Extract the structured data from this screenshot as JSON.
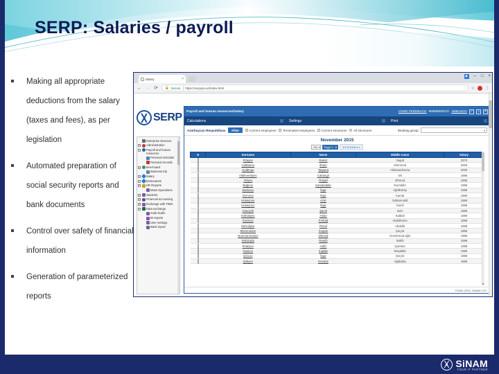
{
  "slide": {
    "title": "SERP: Salaries / payroll",
    "bullets": [
      "Making all appropriate deductions from the salary (taxes and fees), as per legislation",
      "Automated preparation of social security reports and bank documents",
      "Control over safety of financial information",
      "Generation of parameterized reports"
    ],
    "footer_logo": {
      "name": "SiNAM",
      "tagline": "YOUR IT PARTNER"
    }
  },
  "browser": {
    "tab": {
      "title": "Salary",
      "close_label": "×"
    },
    "window_controls": {
      "minimize": "–",
      "maximize": "□",
      "close": "×",
      "extra": "▲"
    },
    "toolbar": {
      "back": "←",
      "forward": "→",
      "reload": "⟳",
      "secure_label": "Secure",
      "url": "https://serpqsu.az/index.html",
      "bookmark": "☆",
      "menu": "⋮"
    }
  },
  "app": {
    "brand": "SERP",
    "titlebar": {
      "title": "Payroll and human resources/Salary",
      "user_feedback": "USER FEEDBACK",
      "user_prefix": "MƏMMƏDOV",
      "user_name": "ABBASOV",
      "btn_ok": "✓",
      "btn_help": "?",
      "btn_close": "✕"
    },
    "menubar": [
      {
        "label": "Calculations",
        "caret": "▤"
      },
      {
        "label": "Settings",
        "caret": "▤"
      },
      {
        "label": "Print",
        "caret": "▤"
      }
    ],
    "filterbar": {
      "org": "Azərbaycan Respublikası",
      "filter_button": "Filter",
      "checkboxes": [
        {
          "label": "Current employees",
          "type": "checkbox"
        },
        {
          "label": "Terminated employees",
          "type": "checkbox"
        },
        {
          "label": "Current structures",
          "type": "checkbox"
        },
        {
          "label": "All structures",
          "type": "radio"
        }
      ],
      "working_group_label": "Working group:",
      "working_group_value": "",
      "working_group_caret": "▾"
    },
    "period": "November 2015",
    "pagination": {
      "page_size": "250",
      "page_size_caret": "▾",
      "page_label": "Page 1 - 6",
      "page_numbers": "1 2 3 4 5 6 » »"
    },
    "table": {
      "columns": [
        "",
        "Surname",
        "Name",
        "Middle name",
        "Salary"
      ],
      "select_all": "■",
      "rows": [
        [
          "Rzayev",
          "Ramiz",
          "Yaqub",
          "3370"
        ],
        [
          "Cabbarov",
          "Ilham",
          "Məmməd",
          "2000"
        ],
        [
          "Goldman",
          "Tatyana",
          "Aleksandrovna",
          "2000"
        ],
        [
          "Allahverdiyev",
          "Cahangir",
          "Əli",
          "1986"
        ],
        [
          "Abiyev",
          "Rəşad",
          "Əhməd",
          "1986"
        ],
        [
          "Bağırov",
          "Kamaləddin",
          "Nurəddin",
          "1986"
        ],
        [
          "Zadəsəv",
          "İlqar",
          "Ağəlkəbəy",
          "1986"
        ],
        [
          "Dəmirov",
          "İlqar",
          "Kamal",
          "1986"
        ],
        [
          "Hüseynov",
          "Azər",
          "Soltanməlid",
          "1986"
        ],
        [
          "Hüseynov",
          "İlqar",
          "Kamil",
          "1986"
        ],
        [
          "Hüseynli",
          "Şamil",
          "Əziz",
          "1986"
        ],
        [
          "Kəlbəliyev",
          "Aslan",
          "Kalbali",
          "1986"
        ],
        [
          "Kərimov",
          "Fərhad",
          "Abdulkərim",
          "1986"
        ],
        [
          "Mirzəliyev",
          "Rəsul",
          "Abdulla",
          "1986"
        ],
        [
          "Məmmədov",
          "Xəqani",
          "Şəryət",
          "1986"
        ],
        [
          "Nurməmmədov",
          "Əhməd",
          "Gəsəhməd oğlu",
          "1986"
        ],
        [
          "Nəbizadə",
          "Ramib",
          "Sahib",
          "1986"
        ],
        [
          "Rzaliyev",
          "Hafiz",
          "Qəmbər",
          "1986"
        ],
        [
          "Nəsirov",
          "İnqilab",
          "Məşallah",
          "1986"
        ],
        [
          "Qılıcov",
          "İlqar",
          "Şəryət",
          "1986"
        ],
        [
          "Qəliyev",
          "Gündüz",
          "Ağababa",
          "1986"
        ]
      ]
    },
    "footer": "©2000-2015, SINAM LTD."
  },
  "sidebar": {
    "items": [
      {
        "label": "Enterprise structure",
        "expander": "",
        "color": "#5f6b7a"
      },
      {
        "label": "Administration",
        "expander": "+",
        "color": "#c0392b"
      },
      {
        "label": "Payroll and human resources",
        "expander": "−",
        "color": "#2a5fa8"
      },
      {
        "label": "Personal schedule",
        "expander": "",
        "color": "#4d7fc4"
      },
      {
        "label": "Personal records",
        "expander": "",
        "color": "#c0392b"
      },
      {
        "label": "time-board",
        "expander": "+",
        "color": "#3f8f6d"
      },
      {
        "label": "Business trip",
        "expander": "",
        "color": "#6b7f99"
      },
      {
        "label": "Salary",
        "expander": "+",
        "color": "#2a7fd4"
      },
      {
        "label": "Dictionaries",
        "expander": "+",
        "color": "#2a7fd4"
      },
      {
        "label": "HR Reports",
        "expander": "+",
        "color": "#d4a017"
      },
      {
        "label": "Mass Operations",
        "expander": "",
        "color": "#7a5fa0"
      },
      {
        "label": "Students",
        "expander": "+",
        "color": "#7a5fa0"
      },
      {
        "label": "Financial accounting",
        "expander": "+",
        "color": "#6f3f9e"
      },
      {
        "label": "Exchange with TIMS",
        "expander": "+",
        "color": "#7a5fa0"
      },
      {
        "label": "Data exchange",
        "expander": "−",
        "color": "#1b6b3a"
      },
      {
        "label": "madi studio",
        "expander": "",
        "color": "#7a5fa0"
      },
      {
        "label": "BI reports",
        "expander": "",
        "color": "#7a5fa0"
      },
      {
        "label": "User settings",
        "expander": "",
        "color": "#7a5fa0"
      },
      {
        "label": "Bank report",
        "expander": "",
        "color": "#7a5fa0"
      }
    ]
  },
  "colors": {
    "title": "#0d1b53",
    "navy": "#1b2a6b",
    "accent": "#2e6db4",
    "banner_teal": "#5ec8d8"
  }
}
